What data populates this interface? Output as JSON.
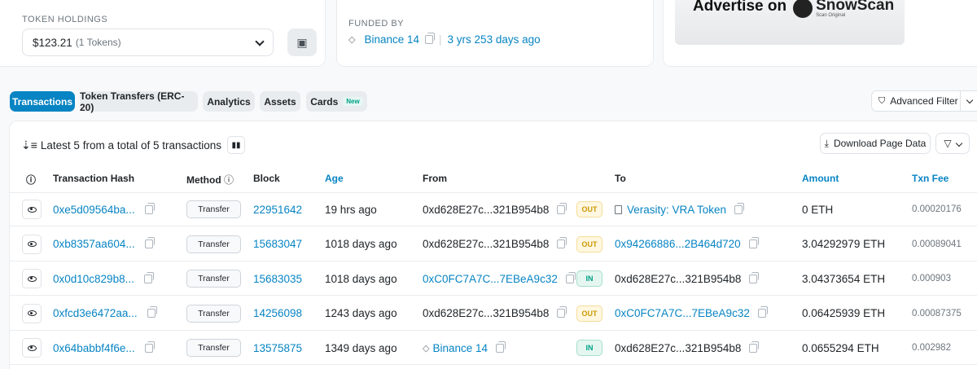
{
  "holdings": {
    "label": "TOKEN HOLDINGS",
    "value": "$123.21",
    "tokens": "(1 Tokens)"
  },
  "funded": {
    "label": "FUNDED BY",
    "source": "Binance 14",
    "age": "3 yrs 253 days ago"
  },
  "ad": {
    "text": "Advertise on",
    "brand": "SnowScan",
    "brand_sub": "Scan Original"
  },
  "tabs": [
    {
      "label": "Transactions",
      "active": true
    },
    {
      "label": "Token Transfers (ERC-20)",
      "active": false
    },
    {
      "label": "Analytics",
      "active": false
    },
    {
      "label": "Assets",
      "active": false
    },
    {
      "label": "Cards",
      "active": false,
      "badge": "New"
    }
  ],
  "advanced_filter": "Advanced Filter",
  "table": {
    "summary": "Latest 5 from a total of 5 transactions",
    "download_label": "Download Page Data",
    "headers": {
      "hash": "Transaction Hash",
      "method": "Method",
      "block": "Block",
      "age": "Age",
      "from": "From",
      "to": "To",
      "amount": "Amount",
      "fee": "Txn Fee"
    },
    "rows": [
      {
        "hash": "0xe5d09564ba...",
        "method": "Transfer",
        "block": "22951642",
        "age": "19 hrs ago",
        "from": "0xd628E27c...321B954b8",
        "dir": "OUT",
        "to": "Verasity: VRA Token",
        "amount": "0 ETH",
        "fee": "0.00020176"
      },
      {
        "hash": "0xb8357aa604...",
        "method": "Transfer",
        "block": "15683047",
        "age": "1018 days ago",
        "from": "0xd628E27c...321B954b8",
        "dir": "OUT",
        "to": "0x94266886...2B464d720",
        "amount": "3.04292979 ETH",
        "fee": "0.00089041"
      },
      {
        "hash": "0x0d10c829b8...",
        "method": "Transfer",
        "block": "15683035",
        "age": "1018 days ago",
        "from": "0xC0FC7A7C...7EBeA9c32",
        "dir": "IN",
        "to": "0xd628E27c...321B954b8",
        "amount": "3.04373654 ETH",
        "fee": "0.000903"
      },
      {
        "hash": "0xfcd3e6472aa...",
        "method": "Transfer",
        "block": "14256098",
        "age": "1243 days ago",
        "from": "0xd628E27c...321B954b8",
        "dir": "OUT",
        "to": "0xC0FC7A7C...7EBeA9c32",
        "amount": "0.06425939 ETH",
        "fee": "0.00087375"
      },
      {
        "hash": "0x64babbf4f6e...",
        "method": "Transfer",
        "block": "13575875",
        "age": "1349 days ago",
        "from": "Binance 14",
        "dir": "IN",
        "to": "0xd628E27c...321B954b8",
        "amount": "0.0655294 ETH",
        "fee": "0.002982"
      }
    ]
  },
  "colors": {
    "accent": "#0784c3",
    "out": "#cc9a06",
    "in": "#00a186"
  }
}
